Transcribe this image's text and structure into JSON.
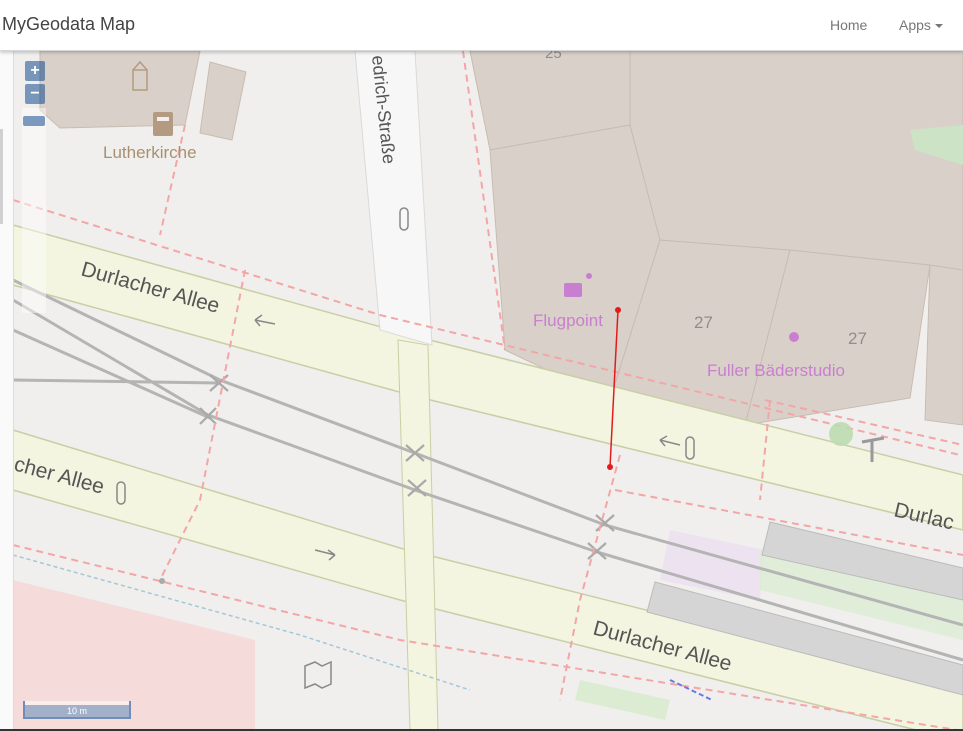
{
  "navbar": {
    "brand": "MyGeodata Map",
    "home": "Home",
    "apps": "Apps"
  },
  "controls": {
    "zoom_in": "+",
    "zoom_out": "−"
  },
  "scale": {
    "label": "10 m"
  },
  "map": {
    "labels": {
      "church": "Lutherkirche",
      "friedrich_street": "edrich-Straße",
      "durlacher_1": "Durlacher Allee",
      "durlacher_2": "cher Allee",
      "durlacher_3": "Durlacher Allee",
      "durlacher_4": "Durlac",
      "flugpoint": "Flugpoint",
      "fuller": "Fuller Bäderstudio",
      "house_27a": "27",
      "house_27b": "27",
      "house_25": "25"
    },
    "colors": {
      "road": "#f3f5e0",
      "rail": "#b4b4b4",
      "boundary": "#f3a6a6",
      "poi": "#c97fcf",
      "measure": "#e31b1b"
    }
  }
}
